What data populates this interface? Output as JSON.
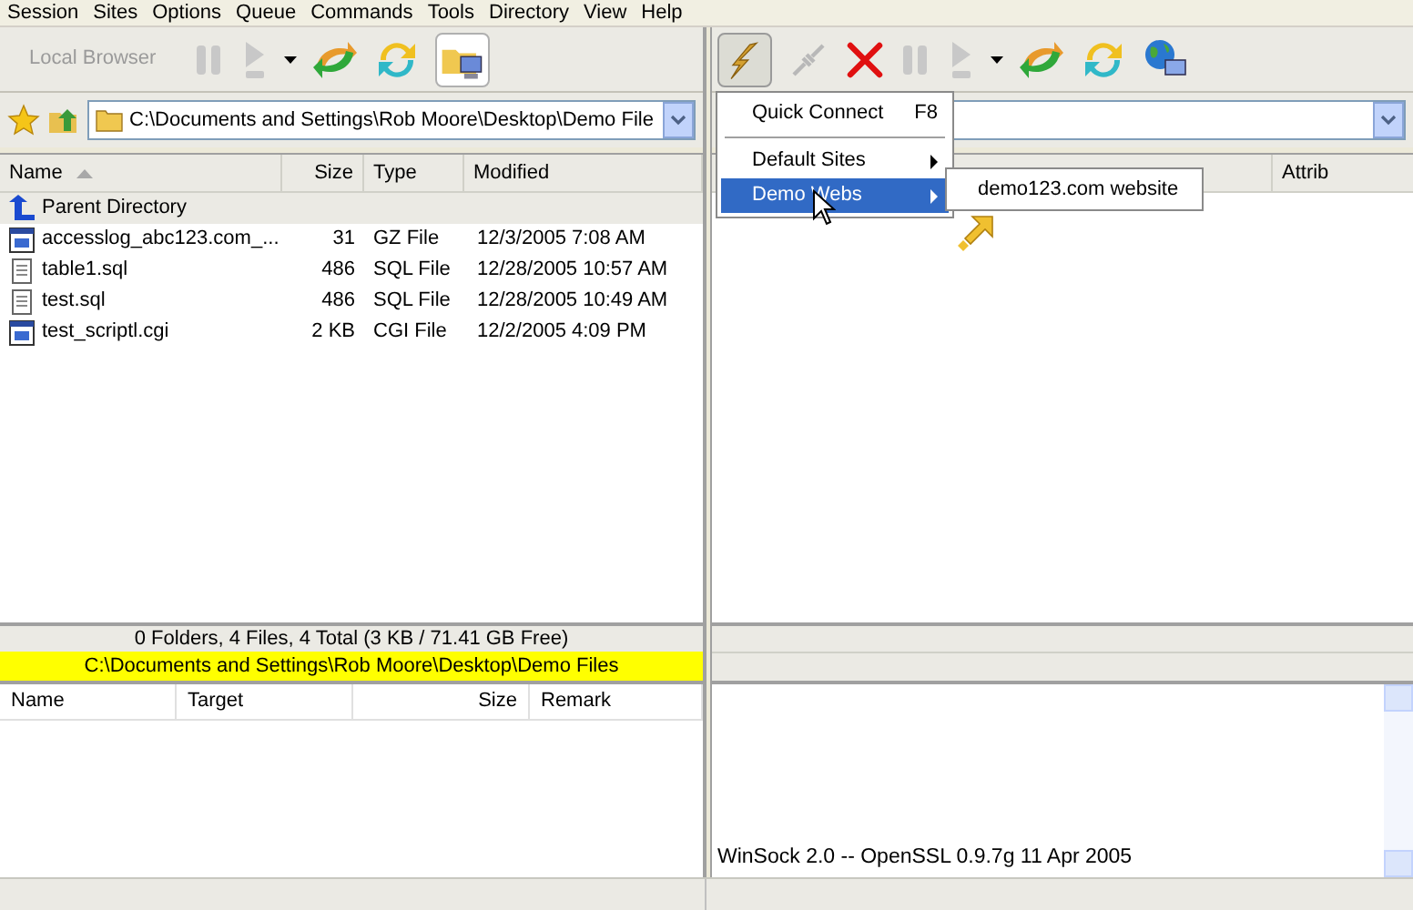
{
  "menu_bar": [
    "Session",
    "Sites",
    "Options",
    "Queue",
    "Commands",
    "Tools",
    "Directory",
    "View",
    "Help"
  ],
  "left_toolbar": {
    "label": "Local Browser"
  },
  "left_address": {
    "path": "C:\\Documents and Settings\\Rob Moore\\Desktop\\Demo File"
  },
  "left_columns": [
    {
      "label": "Name",
      "sorted": true
    },
    {
      "label": "Size",
      "sorted": false
    },
    {
      "label": "Type",
      "sorted": false
    },
    {
      "label": "Modified",
      "sorted": false
    }
  ],
  "left_rows": [
    {
      "kind": "parent",
      "name": "Parent Directory",
      "selected": true
    },
    {
      "kind": "script",
      "name": "accesslog_abc123.com_...",
      "size": "31",
      "type": "GZ File",
      "modified": "12/3/2005 7:08 AM",
      "selected": false
    },
    {
      "kind": "text",
      "name": "table1.sql",
      "size": "486",
      "type": "SQL File",
      "modified": "12/28/2005 10:57 AM",
      "selected": false
    },
    {
      "kind": "text",
      "name": "test.sql",
      "size": "486",
      "type": "SQL File",
      "modified": "12/28/2005 10:49 AM",
      "selected": false
    },
    {
      "kind": "script",
      "name": "test_scriptl.cgi",
      "size": "2 KB",
      "type": "CGI File",
      "modified": "12/2/2005 4:09 PM",
      "selected": false
    }
  ],
  "left_summary": "0 Folders, 4 Files, 4 Total (3 KB / 71.41 GB Free)",
  "left_path_bar": "C:\\Documents and Settings\\Rob Moore\\Desktop\\Demo Files",
  "right_columns": [
    "Attrib"
  ],
  "queue_columns": [
    "Name",
    "Target",
    "Size",
    "Remark"
  ],
  "log_lines": [
    "WinSock 2.0 -- OpenSSL 0.9.7g 11 Apr 2005"
  ],
  "connect_menu": {
    "items": [
      {
        "kind": "item",
        "label": "Quick Connect",
        "shortcut": "F8",
        "selected": false
      },
      {
        "kind": "separator"
      },
      {
        "kind": "submenu",
        "label": "Default Sites",
        "selected": false
      },
      {
        "kind": "submenu",
        "label": "Demo Webs",
        "selected": true
      }
    ]
  },
  "submenu": {
    "items": [
      "demo123.com website"
    ]
  }
}
